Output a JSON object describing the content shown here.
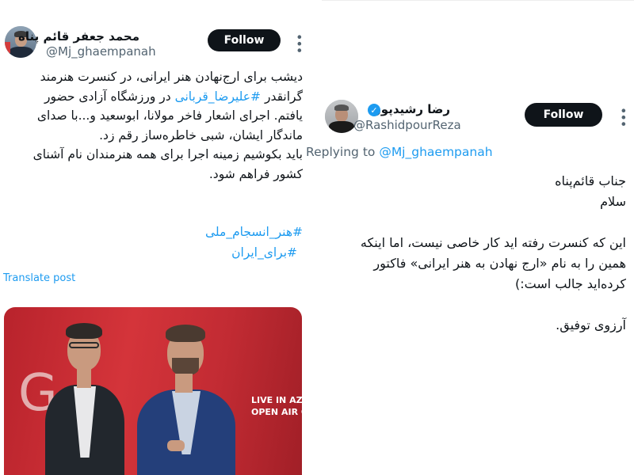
{
  "left_tweet": {
    "author_name": "محمد جعفر قائم پناه",
    "handle": "@Mj_ghaempanah",
    "follow_label": "Follow",
    "text_lines": [
      "دیشب برای ارج‌نهادن هنر ایرانی، در کنسرت هنرمند",
      "گرانقدر ",
      " در ورزشگاه آزادی حضور",
      "یافتم. اجرای اشعار فاخر مولانا، ابوسعید و...با صدای",
      "ماندگار ایشان، شبی خاطره‌ساز رقم زد.",
      "باید بکوشیم زمینه اجرا برای همه هنرمندان نام آشنای",
      "کشور فراهم شود."
    ],
    "inline_hashtag": "#علیرضا_قربانی",
    "hashtags": [
      "#هنر_انسجام_ملی",
      "#برای_ایران"
    ],
    "translate_label": "Translate post",
    "photo": {
      "backdrop_letters": "G",
      "banner_line1": "LIVE IN AZA",
      "banner_line2": "OPEN AIR C"
    }
  },
  "right_tweet": {
    "author_name": "رضا رشیدپور",
    "handle": "@RashidpourReza",
    "follow_label": "Follow",
    "replying_prefix": "Replying to ",
    "replying_mention": "@Mj_ghaempanah",
    "text_lines": [
      "جناب قائم‌پناه",
      "سلام",
      "",
      "این که کنسرت رفته اید کار خاصی نیست، اما اینکه",
      "همین را به نام «ارج نهادن به هنر ایرانی» فاکتور",
      "کرده‌اید جالب است:)",
      "",
      "آرزوی توفیق."
    ]
  },
  "colors": {
    "link": "#1d9bf0",
    "text": "#0f1419",
    "muted": "#536471",
    "button_bg": "#0f1419",
    "photo_bg": "#c22b33"
  },
  "icons": [
    "more-icon",
    "verified-icon"
  ]
}
